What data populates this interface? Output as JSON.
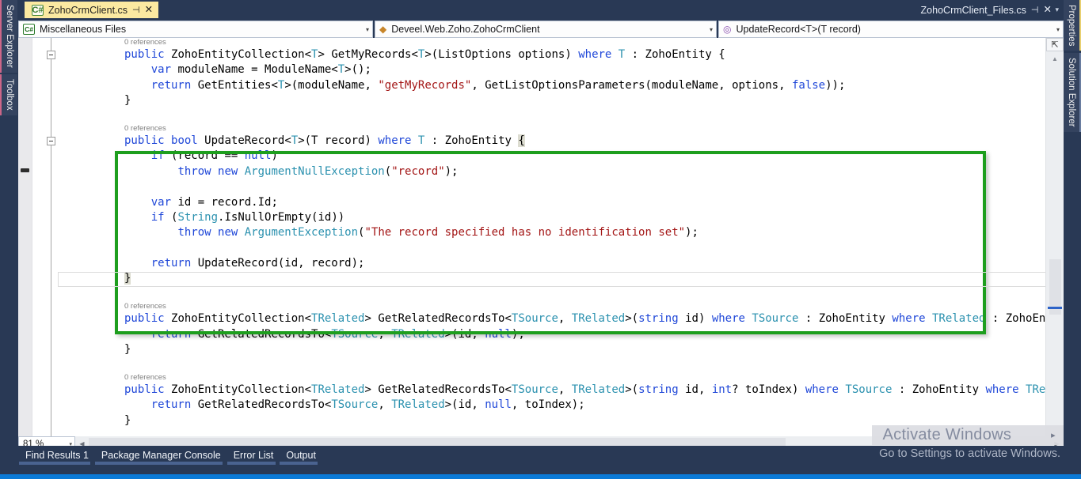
{
  "dock_left": {
    "tabs": [
      {
        "label": "Server Explorer",
        "icon": "server-icon"
      },
      {
        "label": "Toolbox",
        "icon": "toolbox-icon"
      }
    ]
  },
  "dock_right": {
    "tabs": [
      {
        "label": "Properties",
        "icon": "properties-icon"
      },
      {
        "label": "Solution Explorer",
        "icon": "solution-icon"
      }
    ]
  },
  "tabbar": {
    "active_tab": {
      "label": "ZohoCrmClient.cs",
      "icon": "csharp-file-icon",
      "pin": "⊣",
      "close": "✕"
    },
    "inactive_tab": {
      "label": "ZohoCrmClient_Files.cs",
      "pin": "⊣",
      "close": "✕"
    },
    "chevron": "▾"
  },
  "navbar": {
    "project_combo": {
      "value": "Miscellaneous Files",
      "icon": "csharp-badge-icon",
      "badge": "C#",
      "arrow": "▾"
    },
    "type_combo": {
      "value": "Deveel.Web.Zoho.ZohoCrmClient",
      "icon": "namespace-icon",
      "arrow": "▾"
    },
    "member_combo": {
      "value": "UpdateRecord<T>(T record)",
      "icon": "method-icon",
      "arrow": "▾"
    }
  },
  "editor": {
    "references_label": "0 references",
    "fold_glyph": "−",
    "lines": [
      {
        "type": "refs",
        "text": "0 references"
      },
      {
        "type": "code",
        "fold": true,
        "tokens": [
          {
            "t": "public ",
            "c": "kw"
          },
          {
            "t": "ZohoEntityCollection<",
            "c": "pln"
          },
          {
            "t": "T",
            "c": "type"
          },
          {
            "t": "> GetMyRecords<",
            "c": "pln"
          },
          {
            "t": "T",
            "c": "type"
          },
          {
            "t": ">(ListOptions options) ",
            "c": "pln"
          },
          {
            "t": "where ",
            "c": "kw"
          },
          {
            "t": "T",
            "c": "type"
          },
          {
            "t": " : ZohoEntity {",
            "c": "pln"
          }
        ]
      },
      {
        "type": "code",
        "indent": 1,
        "tokens": [
          {
            "t": "    ",
            "c": "pln"
          },
          {
            "t": "var ",
            "c": "kw"
          },
          {
            "t": "moduleName = ModuleName<",
            "c": "pln"
          },
          {
            "t": "T",
            "c": "type"
          },
          {
            "t": ">();",
            "c": "pln"
          }
        ]
      },
      {
        "type": "code",
        "tokens": [
          {
            "t": "    ",
            "c": "pln"
          },
          {
            "t": "return ",
            "c": "kw"
          },
          {
            "t": "GetEntities<",
            "c": "pln"
          },
          {
            "t": "T",
            "c": "type"
          },
          {
            "t": ">(moduleName, ",
            "c": "pln"
          },
          {
            "t": "\"getMyRecords\"",
            "c": "str"
          },
          {
            "t": ", GetListOptionsParameters(moduleName, options, ",
            "c": "pln"
          },
          {
            "t": "false",
            "c": "kw"
          },
          {
            "t": "));",
            "c": "pln"
          }
        ]
      },
      {
        "type": "code",
        "tokens": [
          {
            "t": "}",
            "c": "pln"
          }
        ]
      },
      {
        "type": "blank"
      },
      {
        "type": "refs",
        "text": "0 references"
      },
      {
        "type": "code",
        "fold": true,
        "tokens": [
          {
            "t": "public ",
            "c": "kw"
          },
          {
            "t": "bool ",
            "c": "kw"
          },
          {
            "t": "UpdateRecord<",
            "c": "pln"
          },
          {
            "t": "T",
            "c": "type"
          },
          {
            "t": ">(T record) ",
            "c": "pln"
          },
          {
            "t": "where ",
            "c": "kw"
          },
          {
            "t": "T",
            "c": "type"
          },
          {
            "t": " : ZohoEntity ",
            "c": "pln"
          },
          {
            "t": "{",
            "c": "brace-hl"
          }
        ]
      },
      {
        "type": "code",
        "tokens": [
          {
            "t": "    ",
            "c": "pln"
          },
          {
            "t": "if ",
            "c": "kw"
          },
          {
            "t": "(record == ",
            "c": "pln"
          },
          {
            "t": "null",
            "c": "kw"
          },
          {
            "t": ")",
            "c": "pln"
          }
        ]
      },
      {
        "type": "code",
        "tokens": [
          {
            "t": "        ",
            "c": "pln"
          },
          {
            "t": "throw ",
            "c": "kw"
          },
          {
            "t": "new ",
            "c": "kw"
          },
          {
            "t": "ArgumentNullException",
            "c": "type"
          },
          {
            "t": "(",
            "c": "pln"
          },
          {
            "t": "\"record\"",
            "c": "str"
          },
          {
            "t": ");",
            "c": "pln"
          }
        ]
      },
      {
        "type": "blank"
      },
      {
        "type": "code",
        "tokens": [
          {
            "t": "    ",
            "c": "pln"
          },
          {
            "t": "var ",
            "c": "kw"
          },
          {
            "t": "id = record.Id;",
            "c": "pln"
          }
        ]
      },
      {
        "type": "code",
        "tokens": [
          {
            "t": "    ",
            "c": "pln"
          },
          {
            "t": "if ",
            "c": "kw"
          },
          {
            "t": "(",
            "c": "pln"
          },
          {
            "t": "String",
            "c": "type"
          },
          {
            "t": ".IsNullOrEmpty(id))",
            "c": "pln"
          }
        ]
      },
      {
        "type": "code",
        "tokens": [
          {
            "t": "        ",
            "c": "pln"
          },
          {
            "t": "throw ",
            "c": "kw"
          },
          {
            "t": "new ",
            "c": "kw"
          },
          {
            "t": "ArgumentException",
            "c": "type"
          },
          {
            "t": "(",
            "c": "pln"
          },
          {
            "t": "\"The record specified has no identification set\"",
            "c": "str"
          },
          {
            "t": ");",
            "c": "pln"
          }
        ]
      },
      {
        "type": "blank"
      },
      {
        "type": "code",
        "tokens": [
          {
            "t": "    ",
            "c": "pln"
          },
          {
            "t": "return ",
            "c": "kw"
          },
          {
            "t": "UpdateRecord(id, record);",
            "c": "pln"
          }
        ]
      },
      {
        "type": "code",
        "current": true,
        "tokens": [
          {
            "t": "}",
            "c": "brace-hl"
          }
        ]
      },
      {
        "type": "blank"
      },
      {
        "type": "refs",
        "text": "0 references"
      },
      {
        "type": "code",
        "tokens": [
          {
            "t": "public ",
            "c": "kw"
          },
          {
            "t": "ZohoEntityCollection<",
            "c": "pln"
          },
          {
            "t": "TRelated",
            "c": "type"
          },
          {
            "t": "> GetRelatedRecordsTo<",
            "c": "pln"
          },
          {
            "t": "TSource",
            "c": "type"
          },
          {
            "t": ", ",
            "c": "pln"
          },
          {
            "t": "TRelated",
            "c": "type"
          },
          {
            "t": ">(",
            "c": "pln"
          },
          {
            "t": "string ",
            "c": "kw"
          },
          {
            "t": "id) ",
            "c": "pln"
          },
          {
            "t": "where ",
            "c": "kw"
          },
          {
            "t": "TSource",
            "c": "type"
          },
          {
            "t": " : ZohoEntity ",
            "c": "pln"
          },
          {
            "t": "where ",
            "c": "kw"
          },
          {
            "t": "TRelated",
            "c": "type"
          },
          {
            "t": " : ZohoEnt",
            "c": "pln"
          }
        ]
      },
      {
        "type": "code",
        "tokens": [
          {
            "t": "    ",
            "c": "pln"
          },
          {
            "t": "return ",
            "c": "kw"
          },
          {
            "t": "GetRelatedRecordsTo<",
            "c": "pln"
          },
          {
            "t": "TSource",
            "c": "type"
          },
          {
            "t": ", ",
            "c": "pln"
          },
          {
            "t": "TRelated",
            "c": "type"
          },
          {
            "t": ">(id, ",
            "c": "pln"
          },
          {
            "t": "null",
            "c": "kw"
          },
          {
            "t": ");",
            "c": "pln"
          }
        ]
      },
      {
        "type": "code",
        "tokens": [
          {
            "t": "}",
            "c": "pln"
          }
        ]
      },
      {
        "type": "blank"
      },
      {
        "type": "refs",
        "text": "0 references"
      },
      {
        "type": "code",
        "tokens": [
          {
            "t": "public ",
            "c": "kw"
          },
          {
            "t": "ZohoEntityCollection<",
            "c": "pln"
          },
          {
            "t": "TRelated",
            "c": "type"
          },
          {
            "t": "> GetRelatedRecordsTo<",
            "c": "pln"
          },
          {
            "t": "TSource",
            "c": "type"
          },
          {
            "t": ", ",
            "c": "pln"
          },
          {
            "t": "TRelated",
            "c": "type"
          },
          {
            "t": ">(",
            "c": "pln"
          },
          {
            "t": "string ",
            "c": "kw"
          },
          {
            "t": "id, ",
            "c": "pln"
          },
          {
            "t": "int",
            "c": "kw"
          },
          {
            "t": "? toIndex) ",
            "c": "pln"
          },
          {
            "t": "where ",
            "c": "kw"
          },
          {
            "t": "TSource",
            "c": "type"
          },
          {
            "t": " : ZohoEntity ",
            "c": "pln"
          },
          {
            "t": "where ",
            "c": "kw"
          },
          {
            "t": "TRel",
            "c": "type"
          }
        ]
      },
      {
        "type": "code",
        "tokens": [
          {
            "t": "    ",
            "c": "pln"
          },
          {
            "t": "return ",
            "c": "kw"
          },
          {
            "t": "GetRelatedRecordsTo<",
            "c": "pln"
          },
          {
            "t": "TSource",
            "c": "type"
          },
          {
            "t": ", ",
            "c": "pln"
          },
          {
            "t": "TRelated",
            "c": "type"
          },
          {
            "t": ">(id, ",
            "c": "pln"
          },
          {
            "t": "null",
            "c": "kw"
          },
          {
            "t": ", toIndex);",
            "c": "pln"
          }
        ]
      },
      {
        "type": "code",
        "tokens": [
          {
            "t": "}",
            "c": "pln"
          }
        ]
      }
    ]
  },
  "scrollbar": {
    "split_icon": "⇱",
    "up_arrow": "▲"
  },
  "hscroll": {
    "zoom_level": "81 %",
    "zoom_arrow": "▾",
    "left_arrow": "◀",
    "right_arrow": "▶"
  },
  "bottom_tabs": [
    {
      "label": "Find Results 1"
    },
    {
      "label": "Package Manager Console"
    },
    {
      "label": "Error List"
    },
    {
      "label": "Output"
    }
  ],
  "watermark": {
    "line1": "Activate Windows",
    "arrow": "▸",
    "line2": "Go to Settings to activate Windows."
  },
  "colors": {
    "chrome": "#293955",
    "active_tab": "#fbe9a1",
    "annotation_green": "#1e9e1e",
    "status_blue": "#0b7ad6",
    "keyword": "#1f47d8",
    "type": "#2b91af",
    "string": "#a31515"
  }
}
